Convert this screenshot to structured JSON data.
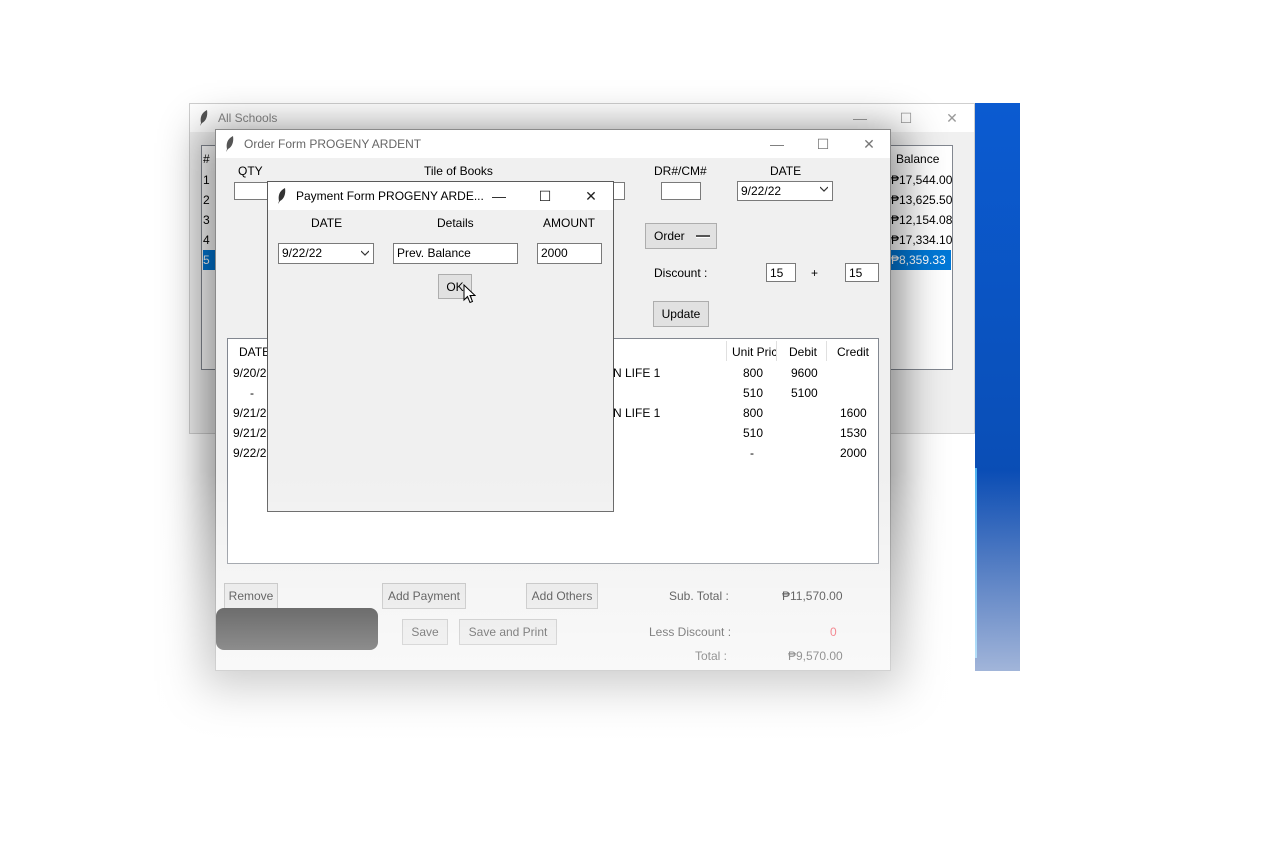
{
  "all_schools": {
    "title": "All Schools",
    "col_balance": "Balance",
    "row_nums": [
      "1",
      "2",
      "3",
      "4",
      "5"
    ],
    "balances": [
      "₱17,544.00",
      "₱13,625.50",
      "₱12,154.08",
      "₱17,334.10",
      "₱8,359.33"
    ],
    "selected_index": 4,
    "col_num": "#"
  },
  "order_form": {
    "title": "Order Form PROGENY ARDENT",
    "qty_label": "QTY",
    "books_label": "Tile of Books",
    "dr_label": "DR#/CM#",
    "date_label": "DATE",
    "date_value": "9/22/22",
    "order_option": "Order",
    "discount_label": "Discount :",
    "discount1": "15",
    "plus": "+",
    "discount2": "15",
    "update_btn": "Update",
    "columns": [
      "DATE",
      "Unit Pric",
      "Debit",
      "Credit"
    ],
    "rows": [
      {
        "date": "9/20/2",
        "title": "N LIFE 1",
        "unit": "800",
        "debit": "9600",
        "credit": ""
      },
      {
        "date": "-",
        "title": "",
        "unit": "510",
        "debit": "5100",
        "credit": ""
      },
      {
        "date": "9/21/2",
        "title": "N LIFE 1",
        "unit": "800",
        "debit": "",
        "credit": "1600"
      },
      {
        "date": "9/21/2",
        "title": "",
        "unit": "510",
        "debit": "",
        "credit": "1530"
      },
      {
        "date": "9/22/2",
        "title": "",
        "unit": "-",
        "debit": "",
        "credit": "2000"
      }
    ],
    "remove_btn": "Remove",
    "add_payment_btn": "Add Payment",
    "add_others_btn": "Add Others",
    "save_btn": "Save",
    "save_print_btn": "Save and Print",
    "subtotal_label": "Sub. Total :",
    "subtotal_value": "₱11,570.00",
    "less_discount_label": "Less Discount :",
    "less_discount_value": "0",
    "total_label": "Total :",
    "total_value": "₱9,570.00"
  },
  "payment_form": {
    "title": "Payment Form PROGENY ARDE...",
    "date_header": "DATE",
    "details_header": "Details",
    "amount_header": "AMOUNT",
    "date_value": "9/22/22",
    "details_value": "Prev. Balance",
    "amount_value": "2000",
    "ok_btn": "OK"
  },
  "colors": {
    "selection": "#0078d7",
    "desktop_blue": "#0a4fb8",
    "discount_red": "#e81123"
  },
  "icons": [
    "feather-icon",
    "minimize-icon",
    "maximize-icon",
    "close-icon",
    "chevron-down-icon",
    "mouse-cursor-icon"
  ]
}
